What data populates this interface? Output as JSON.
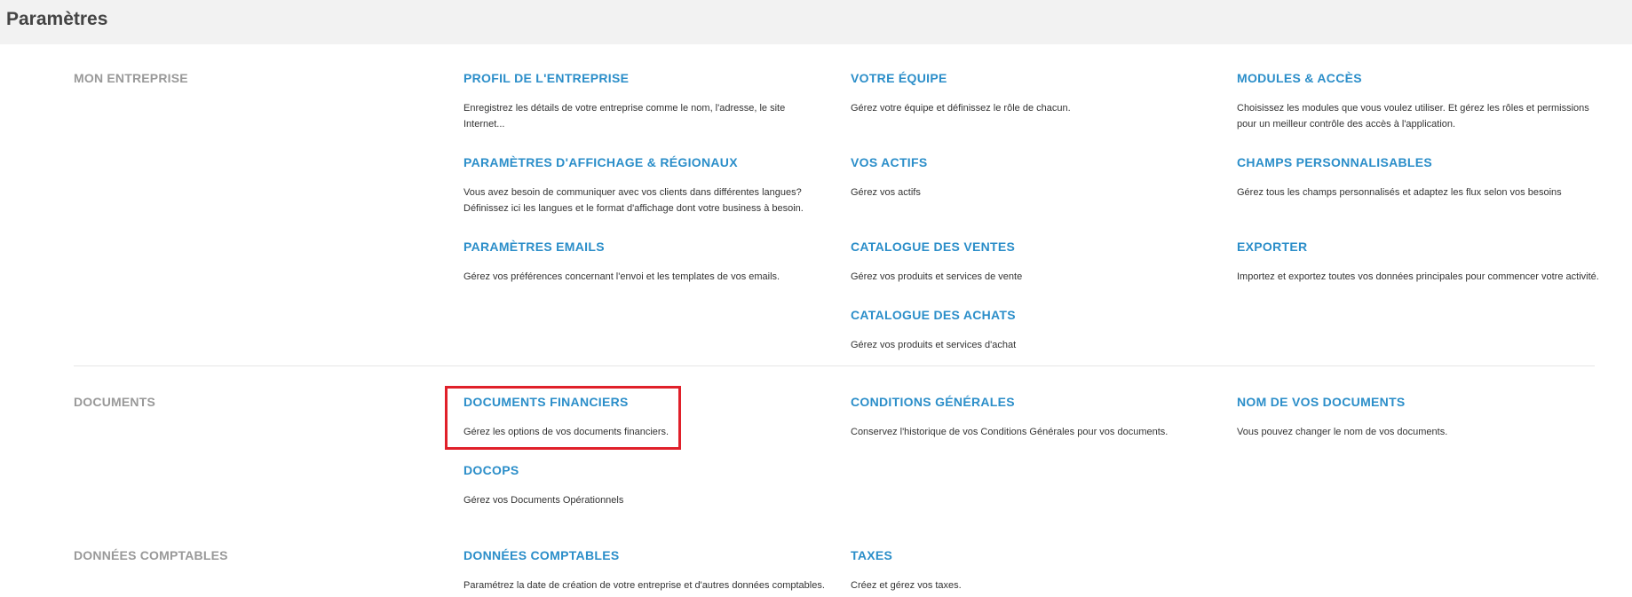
{
  "header": {
    "title": "Paramètres"
  },
  "sections": [
    {
      "title": "MON ENTREPRISE",
      "items": [
        {
          "title": "PROFIL DE L'ENTREPRISE",
          "desc": "Enregistrez les détails de votre entreprise comme le nom, l'adresse, le site Internet..."
        },
        {
          "title": "VOTRE ÉQUIPE",
          "desc": "Gérez votre équipe et définissez le rôle de chacun."
        },
        {
          "title": "MODULES & ACCÈS",
          "desc": "Choisissez les modules que vous voulez utiliser. Et gérez les rôles et permissions pour un meilleur contrôle des accès à l'application."
        },
        {
          "title": "PARAMÈTRES D'AFFICHAGE & RÉGIONAUX",
          "desc": "Vous avez besoin de communiquer avec vos clients dans différentes langues? Définissez ici les langues et le format d'affichage dont votre business à besoin."
        },
        {
          "title": "VOS ACTIFS",
          "desc": "Gérez vos actifs"
        },
        {
          "title": "CHAMPS PERSONNALISABLES",
          "desc": "Gérez tous les champs personnalisés et adaptez les flux selon vos besoins"
        },
        {
          "title": "PARAMÈTRES EMAILS",
          "desc": "Gérez vos préférences concernant l'envoi et les templates de vos emails."
        },
        {
          "title": "CATALOGUE DES VENTES",
          "desc": "Gérez vos produits et services de vente"
        },
        {
          "title": "EXPORTER",
          "desc": "Importez et exportez toutes vos données principales pour commencer votre activité."
        },
        {
          "title": "CATALOGUE DES ACHATS",
          "desc": "Gérez vos produits et services d'achat"
        }
      ]
    },
    {
      "title": "DOCUMENTS",
      "items": [
        {
          "title": "DOCUMENTS FINANCIERS",
          "desc": "Gérez les options de vos documents financiers."
        },
        {
          "title": "CONDITIONS GÉNÉRALES",
          "desc": "Conservez l'historique de vos Conditions Générales pour vos documents."
        },
        {
          "title": "NOM DE VOS DOCUMENTS",
          "desc": "Vous pouvez changer le nom de vos documents."
        },
        {
          "title": "DOCOPS",
          "desc": "Gérez vos Documents Opérationnels"
        }
      ]
    },
    {
      "title": "DONNÉES COMPTABLES",
      "items": [
        {
          "title": "DONNÉES COMPTABLES",
          "desc": "Paramétrez la date de création de votre entreprise et d'autres données comptables."
        },
        {
          "title": "TAXES",
          "desc": "Créez et gérez vos taxes."
        }
      ]
    }
  ],
  "highlight_color": "#e0202a",
  "link_color": "#2b8ec9"
}
